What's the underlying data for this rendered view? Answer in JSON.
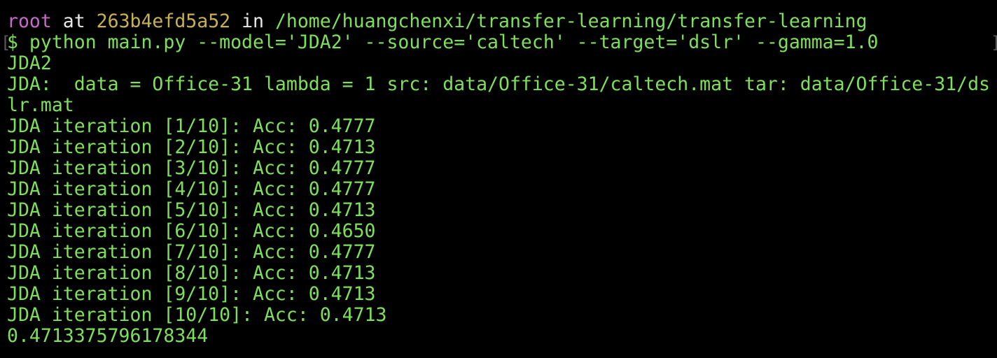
{
  "terminal": {
    "colors": {
      "background": "#000000",
      "output": "#7ee05a",
      "user": "#c868c8",
      "host": "#c8b050",
      "plain": "#e8e8e8"
    },
    "prompt": {
      "user": "root",
      "at": " at ",
      "host": "263b4efd5a52",
      "in": " in ",
      "path": "/home/huangchenxi/transfer-learning/transfer-learning",
      "symbol": "$",
      "command": " python main.py --model='JDA2' --source='caltech' --target='dslr' --gamma=1.0",
      "bracket_left": "[",
      "bracket_right": "]"
    },
    "output": [
      "JDA2",
      "JDA:  data = Office-31 lambda = 1 src: data/Office-31/caltech.mat tar: data/Office-31/ds",
      "lr.mat",
      "JDA iteration [1/10]: Acc: 0.4777",
      "JDA iteration [2/10]: Acc: 0.4713",
      "JDA iteration [3/10]: Acc: 0.4777",
      "JDA iteration [4/10]: Acc: 0.4777",
      "JDA iteration [5/10]: Acc: 0.4713",
      "JDA iteration [6/10]: Acc: 0.4650",
      "JDA iteration [7/10]: Acc: 0.4777",
      "JDA iteration [8/10]: Acc: 0.4713",
      "JDA iteration [9/10]: Acc: 0.4713",
      "JDA iteration [10/10]: Acc: 0.4713",
      "0.4713375796178344"
    ]
  }
}
